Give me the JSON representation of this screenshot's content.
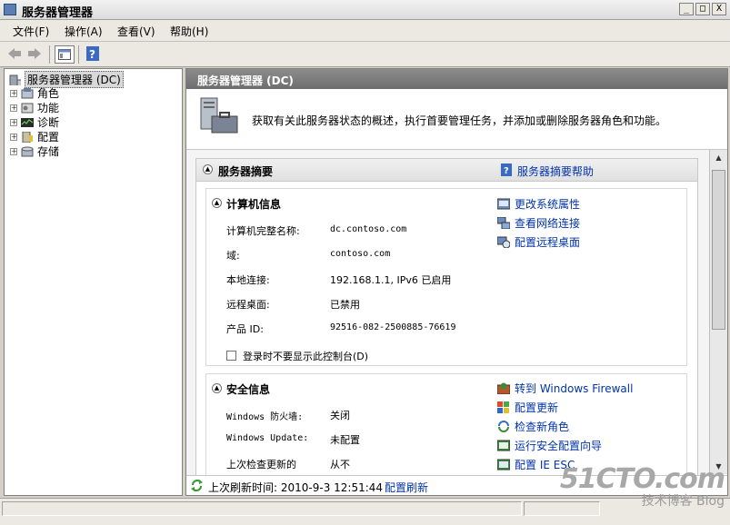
{
  "window": {
    "title": "服务器管理器",
    "controls": [
      "_",
      "□",
      "X"
    ]
  },
  "menu": [
    "文件(F)",
    "操作(A)",
    "查看(V)",
    "帮助(H)"
  ],
  "toolbar": {
    "icons": [
      "back-arrow-icon",
      "forward-arrow-icon",
      "show-hide-console-tree-icon",
      "help-icon"
    ]
  },
  "tree": {
    "root": "服务器管理器 (DC)",
    "items": [
      {
        "label": "角色",
        "icon": "roles-icon"
      },
      {
        "label": "功能",
        "icon": "features-icon"
      },
      {
        "label": "诊断",
        "icon": "diagnostics-icon"
      },
      {
        "label": "配置",
        "icon": "configuration-icon"
      },
      {
        "label": "存储",
        "icon": "storage-icon"
      }
    ]
  },
  "main": {
    "header": "服务器管理器 (DC)",
    "intro": "获取有关此服务器状态的概述，执行首要管理任务，并添加或删除服务器角色和功能。"
  },
  "summary": {
    "title": "服务器摘要",
    "help_link": "服务器摘要帮助",
    "computer_info": {
      "title": "计算机信息",
      "rows": [
        {
          "label": "计算机完整名称:",
          "value": "dc.contoso.com"
        },
        {
          "label": "域:",
          "value": "contoso.com"
        },
        {
          "label": "本地连接:",
          "value": "192.168.1.1, IPv6 已启用"
        },
        {
          "label": "远程桌面:",
          "value": "已禁用"
        },
        {
          "label": "产品 ID:",
          "value": "92516-082-2500885-76619"
        }
      ],
      "checkbox": "登录时不要显示此控制台(D)",
      "tasks": [
        "更改系统属性",
        "查看网络连接",
        "配置远程桌面"
      ]
    },
    "security_info": {
      "title": "安全信息",
      "rows": [
        {
          "label": "Windows 防火墙:",
          "value": "关闭"
        },
        {
          "label": "Windows Update:",
          "value": "未配置"
        },
        {
          "label": "上次检查更新的",
          "value": "从不"
        }
      ],
      "tasks": [
        "转到 Windows Firewall",
        "配置更新",
        "检查新角色",
        "运行安全配置向导",
        "配置 IE ESC"
      ]
    }
  },
  "footer": {
    "refresh_text": "上次刷新时间: 2010-9-3 12:51:44",
    "refresh_link": "配置刷新"
  },
  "watermark": {
    "line1": "51CTO.com",
    "line2": "技术博客",
    "line3": "Blog"
  }
}
